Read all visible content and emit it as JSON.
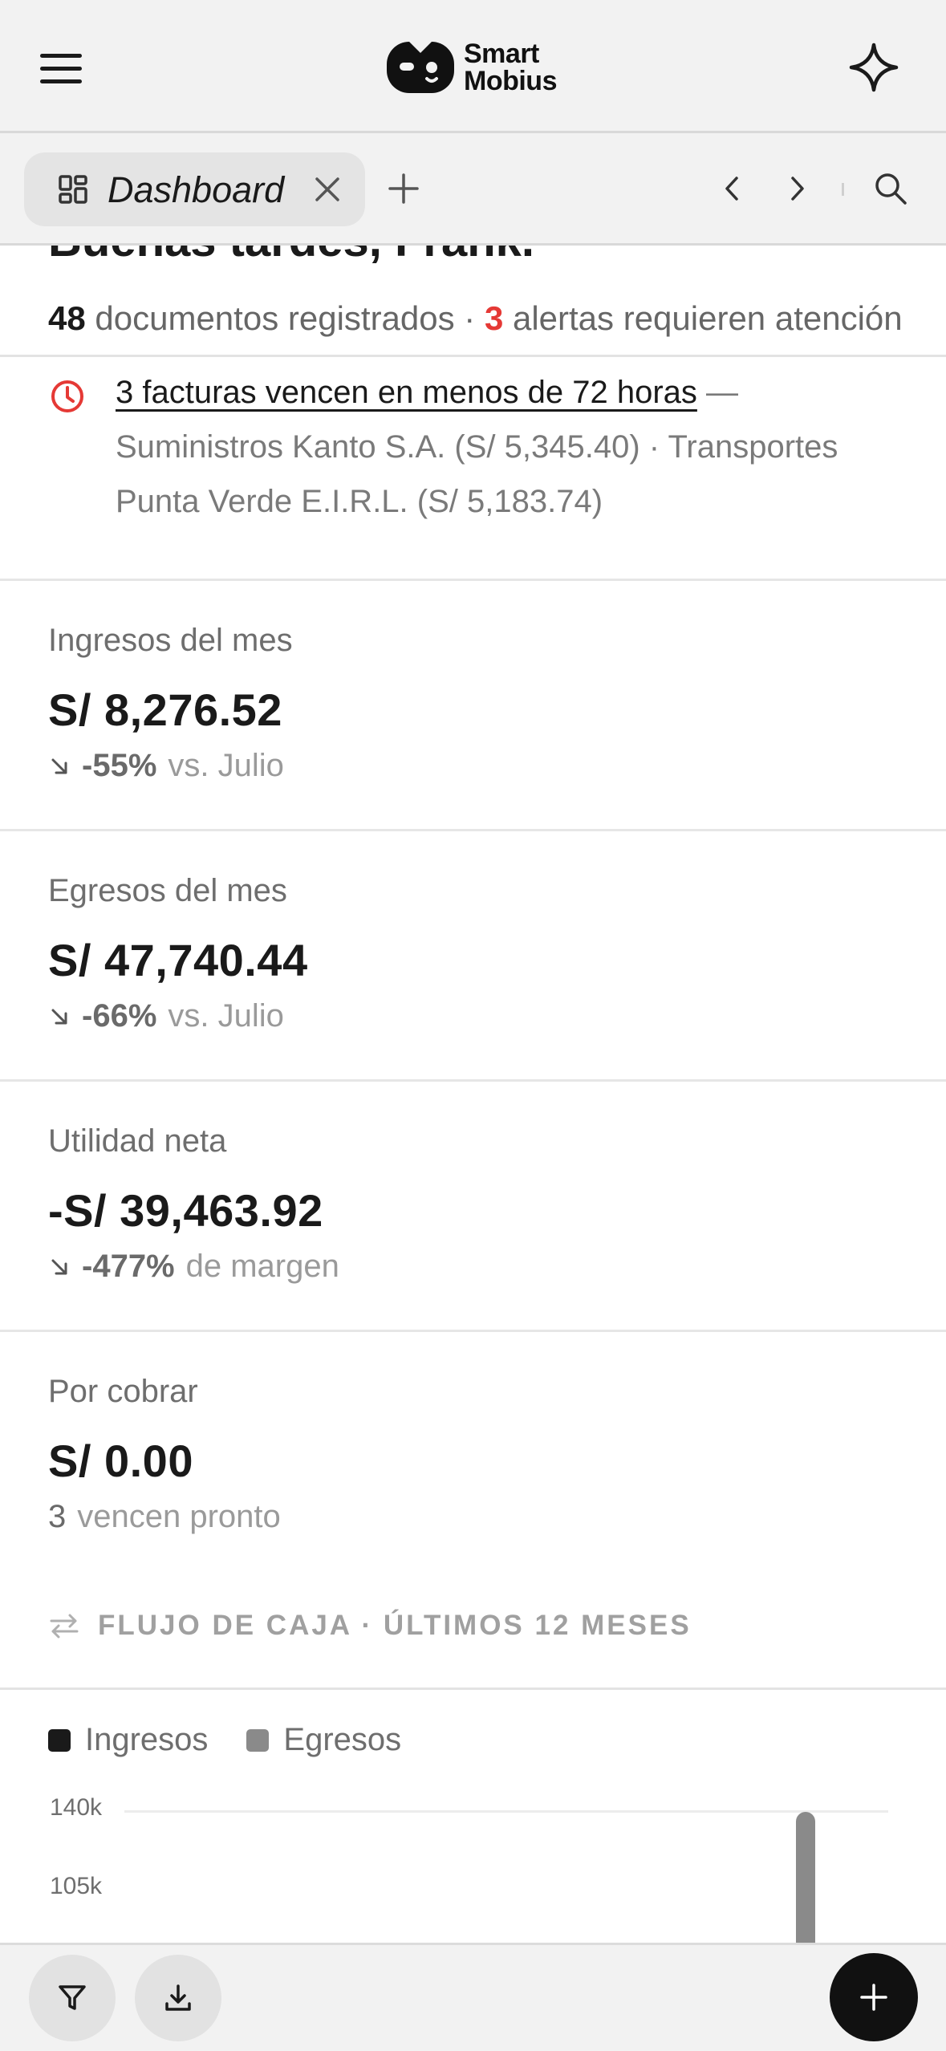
{
  "app": {
    "logo_line1": "Smart",
    "logo_line2": "Mobius",
    "icons": {
      "menu": "hamburger-menu-icon",
      "assistant": "sparkle-icon"
    }
  },
  "tabs": {
    "active_label": "Dashboard",
    "icons": [
      "dashboard-grid-icon",
      "close-icon",
      "plus-icon",
      "chevron-left-icon",
      "chevron-right-icon",
      "search-icon"
    ]
  },
  "greeting": {
    "text": "Buenas tardes, Frank."
  },
  "summary": {
    "doc_count": "48",
    "doc_text": " documentos registrados · ",
    "alert_count": "3",
    "alert_text": " alertas requieren atención"
  },
  "alert": {
    "link_text": "3 facturas vencen en menos de 72 horas",
    "dash": " — ",
    "detail": "Suministros Kanto S.A. (S/ 5,345.40) · Transportes Punta Verde E.I.R.L. (S/ 5,183.74)"
  },
  "cards": [
    {
      "label": "Ingresos del mes",
      "value": "S/ 8,276.52",
      "change": "-55%",
      "suffix": "vs. Julio"
    },
    {
      "label": "Egresos del mes",
      "value": "S/ 47,740.44",
      "change": "-66%",
      "suffix": "vs. Julio"
    },
    {
      "label": "Utilidad neta",
      "value": "-S/ 39,463.92",
      "change": "-477%",
      "suffix": "de margen"
    },
    {
      "label": "Por cobrar",
      "value": "S/ 0.00",
      "count": "3",
      "suffix": "vencen pronto"
    }
  ],
  "cashflow": {
    "title": "FLUJO DE CAJA · ÚLTIMOS 12 MESES",
    "legend": {
      "income": "Ingresos",
      "expense": "Egresos"
    },
    "colors": {
      "income": "#1a1a1a",
      "expense": "#8a8a8a",
      "alert": "#e53935"
    },
    "ticks": [
      "140k",
      "105k"
    ]
  },
  "chart_data": {
    "type": "bar",
    "title": "FLUJO DE CAJA · ÚLTIMOS 12 MESES",
    "series": [
      {
        "name": "Ingresos",
        "values": []
      },
      {
        "name": "Egresos",
        "values": []
      }
    ],
    "y_ticks": [
      140000,
      105000
    ],
    "ylim": [
      0,
      140000
    ],
    "visible_note": "Chart is cut off; only one tall Egresos bar is partially visible at the right edge.",
    "legend_placement": "top-left"
  }
}
